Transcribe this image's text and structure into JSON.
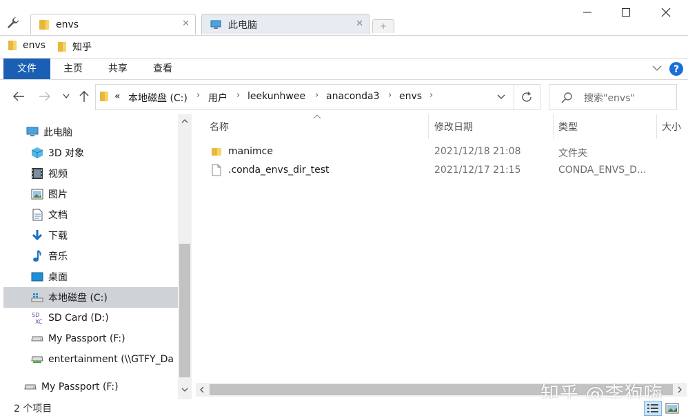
{
  "window": {
    "tabs": [
      {
        "label": "envs",
        "active": true,
        "icon": "folder-icon"
      },
      {
        "label": "此电脑",
        "active": false,
        "icon": "computer-icon"
      }
    ],
    "new_tab_symbol": "+",
    "controls": {
      "minimize": "minimize-icon",
      "maximize": "maximize-icon",
      "close": "close-icon"
    }
  },
  "favorites": [
    {
      "label": "envs"
    },
    {
      "label": "知乎"
    }
  ],
  "ribbon": {
    "tabs": [
      "文件",
      "主页",
      "共享",
      "查看"
    ],
    "accent": "#1a5fb4"
  },
  "address": {
    "overflow": "«",
    "crumbs": [
      "本地磁盘 (C:)",
      "用户",
      "leekunhwee",
      "anaconda3",
      "envs"
    ]
  },
  "search": {
    "placeholder": "搜索\"envs\""
  },
  "nav": {
    "items": [
      {
        "label": "此电脑",
        "icon": "computer-icon"
      },
      {
        "label": "3D 对象",
        "icon": "3d-objects-icon"
      },
      {
        "label": "视频",
        "icon": "video-icon"
      },
      {
        "label": "图片",
        "icon": "pictures-icon"
      },
      {
        "label": "文档",
        "icon": "documents-icon"
      },
      {
        "label": "下载",
        "icon": "download-icon"
      },
      {
        "label": "音乐",
        "icon": "music-icon"
      },
      {
        "label": "桌面",
        "icon": "desktop-icon"
      },
      {
        "label": "本地磁盘 (C:)",
        "icon": "local-disk-icon",
        "selected": true
      },
      {
        "label": "SD Card (D:)",
        "icon": "sd-card-icon"
      },
      {
        "label": "My Passport (F:)",
        "icon": "drive-icon"
      },
      {
        "label": "entertainment (\\\\GTFY_Da",
        "icon": "network-drive-icon"
      },
      {
        "label": "My Passport (F:)",
        "icon": "drive-icon"
      }
    ]
  },
  "filelist": {
    "columns": [
      "名称",
      "修改日期",
      "类型",
      "大小"
    ],
    "rows": [
      {
        "name": "manimce",
        "date": "2021/12/18 21:08",
        "type": "文件夹",
        "icon": "folder-icon"
      },
      {
        "name": ".conda_envs_dir_test",
        "date": "2021/12/17 21:15",
        "type": "CONDA_ENVS_D...",
        "icon": "file-icon"
      }
    ]
  },
  "status": {
    "count": "2 个项目"
  },
  "watermark": "知乎 @李狗嗨"
}
